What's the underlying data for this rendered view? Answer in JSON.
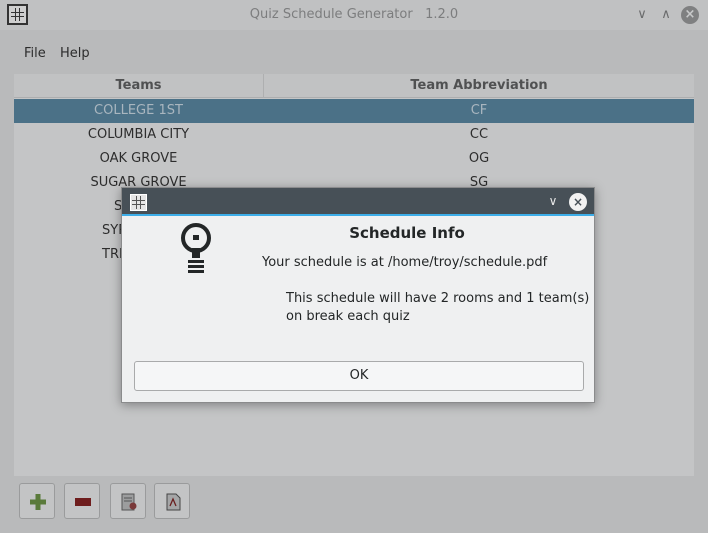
{
  "window": {
    "title": "Quiz Schedule Generator",
    "version": "1.2.0",
    "min_glyph": "∨",
    "max_glyph": "∧",
    "close_glyph": "×"
  },
  "menu": {
    "file": "File",
    "help": "Help"
  },
  "table": {
    "headers": {
      "teams": "Teams",
      "abbrev": "Team Abbreviation"
    },
    "rows": [
      {
        "team": "COLLEGE 1ST",
        "abbrev": "CF"
      },
      {
        "team": "COLUMBIA CITY",
        "abbrev": "CC"
      },
      {
        "team": "OAK GROVE",
        "abbrev": "OG"
      },
      {
        "team": "SUGAR GROVE",
        "abbrev": "SG"
      },
      {
        "team": "SY",
        "abbrev": ""
      },
      {
        "team": "SYR",
        "abbrev": ""
      },
      {
        "team": "TRI",
        "abbrev": ""
      }
    ]
  },
  "toolbar": {
    "buttons": [
      "add-team",
      "remove-team",
      "generate-schedule",
      "export-pdf"
    ]
  },
  "dialog": {
    "min_glyph": "∨",
    "close_glyph": "×",
    "heading": "Schedule Info",
    "line1": "Your schedule is at /home/troy/schedule.pdf",
    "line2": "This schedule will have 2 rooms and 1 team(s)",
    "line3": "on break each quiz",
    "ok_label": "OK"
  },
  "colors": {
    "selection": "#4b7187",
    "accent": "#3daee9",
    "dialog_titlebar": "#475057"
  }
}
